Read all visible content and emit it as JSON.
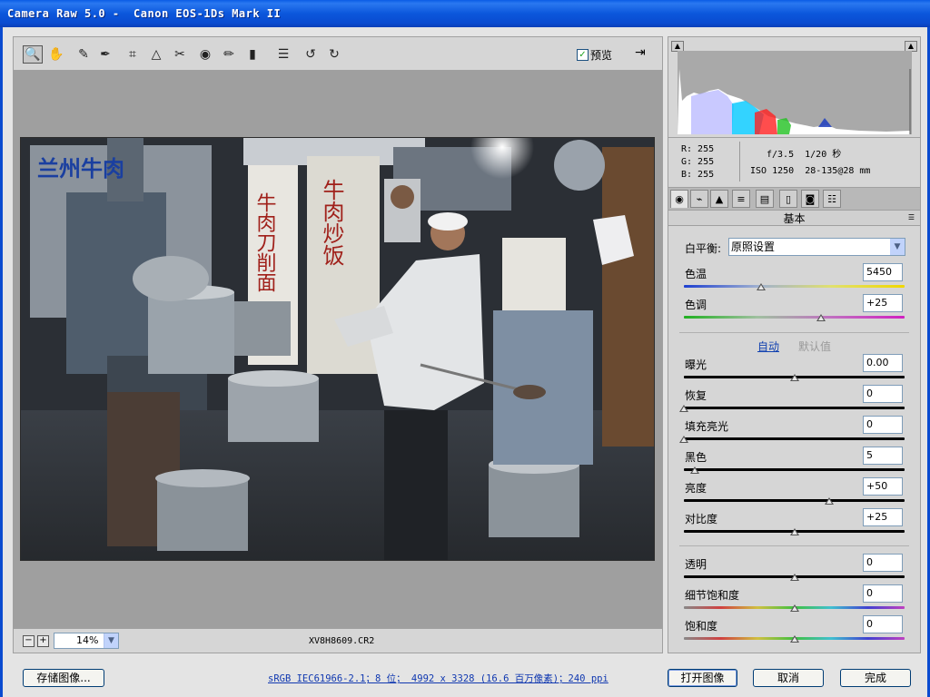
{
  "window": {
    "title": "Camera Raw 5.0 -  Canon EOS-1Ds Mark II"
  },
  "toolbar": {
    "tools": [
      {
        "name": "zoom-tool",
        "icon": "magnifier-icon",
        "glyph": "🔍"
      },
      {
        "name": "hand-tool",
        "icon": "hand-icon",
        "glyph": "✋"
      },
      {
        "name": "white-balance-tool",
        "icon": "eyedropper-icon",
        "glyph": "✎"
      },
      {
        "name": "color-sampler-tool",
        "icon": "color-sampler-icon",
        "glyph": "✒"
      },
      {
        "name": "crop-tool",
        "icon": "crop-icon",
        "glyph": "⌗"
      },
      {
        "name": "straighten-tool",
        "icon": "straighten-icon",
        "glyph": "△"
      },
      {
        "name": "spot-removal-tool",
        "icon": "spot-removal-icon",
        "glyph": "✂"
      },
      {
        "name": "red-eye-tool",
        "icon": "red-eye-icon",
        "glyph": "◉"
      },
      {
        "name": "adjustment-brush-tool",
        "icon": "brush-icon",
        "glyph": "✏"
      },
      {
        "name": "graduated-filter-tool",
        "icon": "graduated-filter-icon",
        "glyph": "▮"
      },
      {
        "name": "preferences-tool",
        "icon": "list-icon",
        "glyph": "☰"
      },
      {
        "name": "rotate-left-tool",
        "icon": "rotate-left-icon",
        "glyph": "↺"
      },
      {
        "name": "rotate-right-tool",
        "icon": "rotate-right-icon",
        "glyph": "↻"
      }
    ],
    "preview_label": "预览",
    "preview_checked": true
  },
  "zoom": {
    "value": "14%",
    "filename": "XV8H8609.CR2"
  },
  "info": {
    "rgb": "R: 255\nG: 255\nB: 255",
    "exposure": "f/3.5  1/20 秒",
    "lens": "ISO 1250  28-135@28 mm"
  },
  "photo": {
    "sign_top_left": "兰州牛肉",
    "sign_left": "牛肉刀削面",
    "sign_right": "牛肉炒饭"
  },
  "panel": {
    "title": "基本",
    "wb_label": "白平衡:",
    "wb_value": "原照设置",
    "auto": "自动",
    "default": "默认值",
    "sliders": [
      {
        "label": "色温",
        "value": "5450",
        "pos": 0.35,
        "track": "temp"
      },
      {
        "label": "色调",
        "value": "+25",
        "pos": 0.62,
        "track": "tint"
      },
      {
        "label": "曝光",
        "value": "0.00",
        "pos": 0.5,
        "track": "plain"
      },
      {
        "label": "恢复",
        "value": "0",
        "pos": 0.0,
        "track": "plain"
      },
      {
        "label": "填充亮光",
        "value": "0",
        "pos": 0.0,
        "track": "plain"
      },
      {
        "label": "黑色",
        "value": "5",
        "pos": 0.05,
        "track": "plain"
      },
      {
        "label": "亮度",
        "value": "+50",
        "pos": 0.66,
        "track": "plain"
      },
      {
        "label": "对比度",
        "value": "+25",
        "pos": 0.5,
        "track": "plain"
      },
      {
        "label": "透明",
        "value": "0",
        "pos": 0.5,
        "track": "plain"
      },
      {
        "label": "细节饱和度",
        "value": "0",
        "pos": 0.5,
        "track": "sat"
      },
      {
        "label": "饱和度",
        "value": "0",
        "pos": 0.5,
        "track": "sat"
      }
    ]
  },
  "bottom": {
    "save": "存储图像...",
    "workflow": "sRGB IEC61966-2.1；8 位； 4992 x 3328 (16.6 百万像素)；240 ppi",
    "open": "打开图像",
    "cancel": "取消",
    "done": "完成"
  }
}
